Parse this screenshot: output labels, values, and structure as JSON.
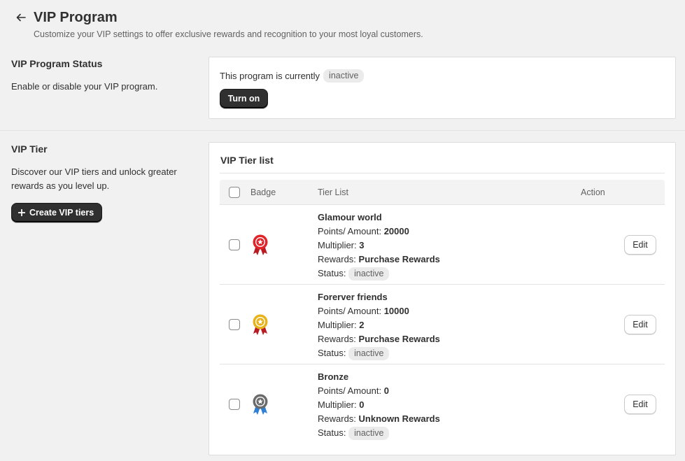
{
  "header": {
    "title": "VIP Program",
    "subtitle": "Customize your VIP settings to offer exclusive rewards and recognition to your most loyal customers."
  },
  "status_section": {
    "heading": "VIP Program Status",
    "description": "Enable or disable your VIP program.",
    "status_text": "This program is currently",
    "status_badge": "inactive",
    "toggle_button": "Turn on"
  },
  "tier_section": {
    "heading": "VIP Tier",
    "description": "Discover our VIP tiers and unlock greater rewards as you level up.",
    "create_button": "Create VIP tiers"
  },
  "tier_list": {
    "title": "VIP Tier list",
    "columns": {
      "badge": "Badge",
      "tier": "Tier List",
      "action": "Action"
    },
    "labels": {
      "points": "Points/ Amount:",
      "multiplier": "Multiplier:",
      "rewards": "Rewards:",
      "status": "Status:"
    },
    "edit_label": "Edit",
    "rows": [
      {
        "name": "Glamour world",
        "points": "20000",
        "multiplier": "3",
        "rewards": "Purchase Rewards",
        "status": "inactive",
        "medal": "red-medal-icon",
        "medal_color": "#e0242a"
      },
      {
        "name": "Forerver friends",
        "points": "10000",
        "multiplier": "2",
        "rewards": "Purchase Rewards",
        "status": "inactive",
        "medal": "gold-medal-icon",
        "medal_color": "#e8b21a"
      },
      {
        "name": "Bronze",
        "points": "0",
        "multiplier": "0",
        "rewards": "Unknown Rewards",
        "status": "inactive",
        "medal": "gray-medal-icon",
        "medal_color": "#6b6b6b"
      }
    ]
  }
}
